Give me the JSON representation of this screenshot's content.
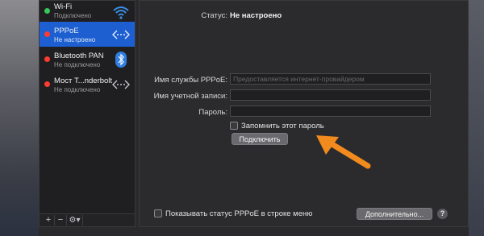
{
  "services": [
    {
      "name": "Wi-Fi",
      "state": "Подключено",
      "status_color": "#35c759",
      "icon": "wifi-icon"
    },
    {
      "name": "PPPoE",
      "state": "Не настроено",
      "status_color": "#ff3b30",
      "icon": "connection-arrows-icon"
    },
    {
      "name": "Bluetooth PAN",
      "state": "Не подключено",
      "status_color": "#ff3b30",
      "icon": "bluetooth-icon"
    },
    {
      "name": "Мост T...nderbolt",
      "state": "Не подключено",
      "status_color": "#ff3b30",
      "icon": "connection-arrows-icon"
    }
  ],
  "selected_service": "PPPoE",
  "toolbar": {
    "add_label": "+",
    "remove_label": "−",
    "gear_label": "⚙▾"
  },
  "main": {
    "status_label": "Статус:",
    "status_value": "Не настроено",
    "service_name_label": "Имя службы PPPoE:",
    "service_name_placeholder": "Предоставляется интернет-провайдером",
    "account_label": "Имя учетной записи:",
    "account_value": "",
    "password_label": "Пароль:",
    "password_value": "",
    "remember_label": "Запомнить этот пароль",
    "connect_label": "Подключить",
    "show_status_label": "Показывать статус PPPoE в строке меню",
    "advanced_label": "Дополнительно...",
    "help_label": "?"
  },
  "colors": {
    "selection": "#1d5fd1",
    "annotation_arrow": "#f28b1e"
  }
}
